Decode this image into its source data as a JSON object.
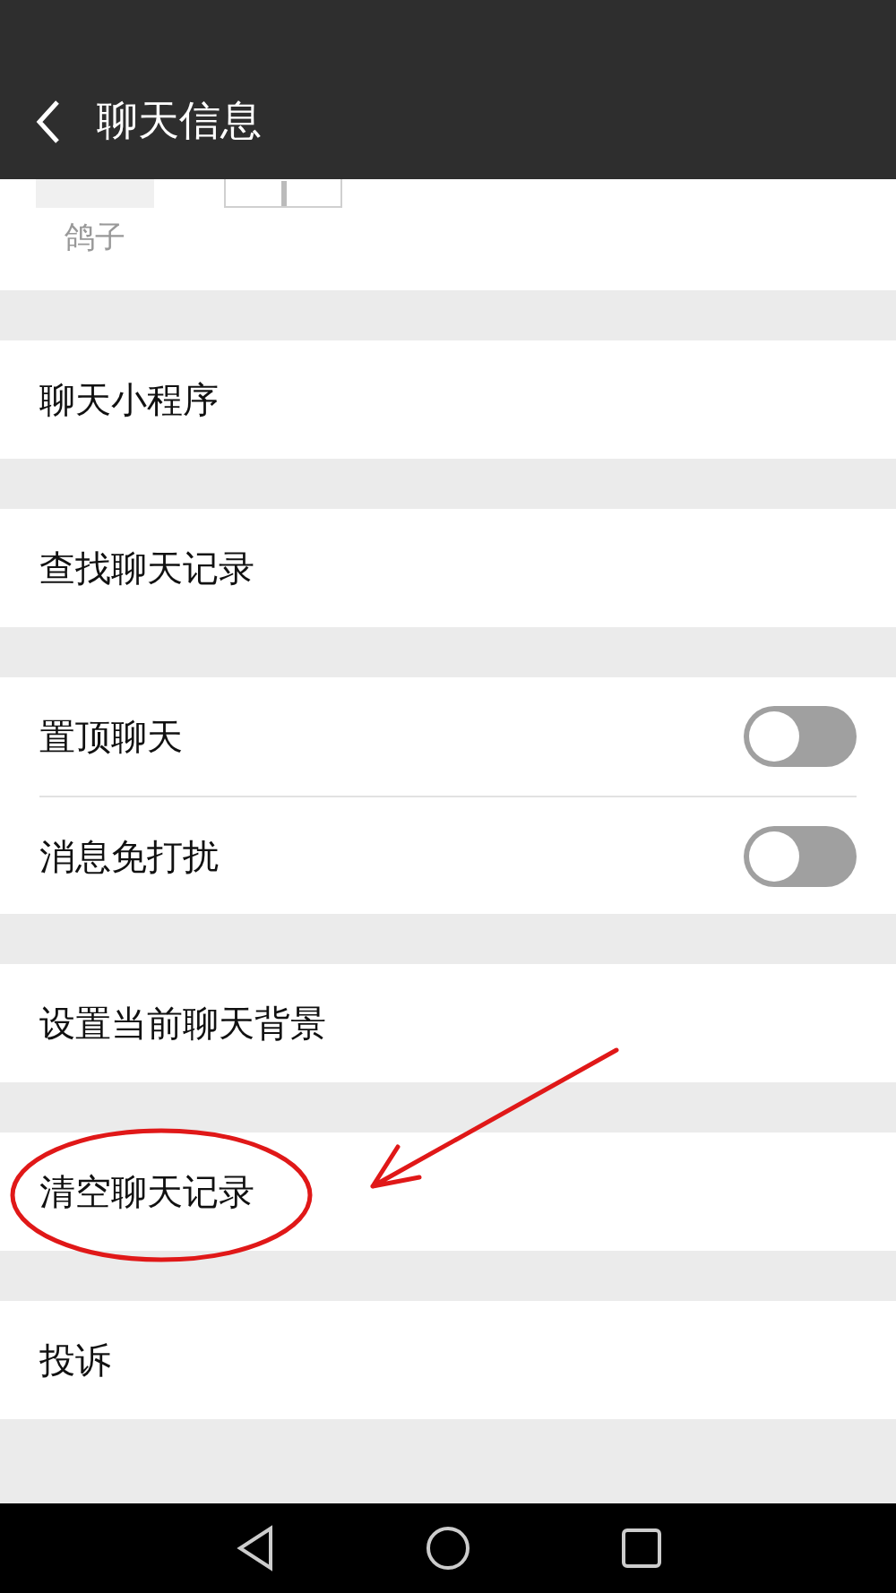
{
  "header": {
    "title": "聊天信息"
  },
  "members": [
    {
      "name": "鸽子",
      "kind": "member"
    },
    {
      "kind": "add"
    }
  ],
  "sections": [
    [
      {
        "label": "聊天小程序",
        "kind": "link"
      }
    ],
    [
      {
        "label": "查找聊天记录",
        "kind": "link"
      }
    ],
    [
      {
        "label": "置顶聊天",
        "kind": "toggle",
        "on": false
      },
      {
        "label": "消息免打扰",
        "kind": "toggle",
        "on": false
      }
    ],
    [
      {
        "label": "设置当前聊天背景",
        "kind": "link"
      }
    ],
    [
      {
        "label": "清空聊天记录",
        "kind": "link"
      }
    ],
    [
      {
        "label": "投诉",
        "kind": "link"
      }
    ]
  ]
}
